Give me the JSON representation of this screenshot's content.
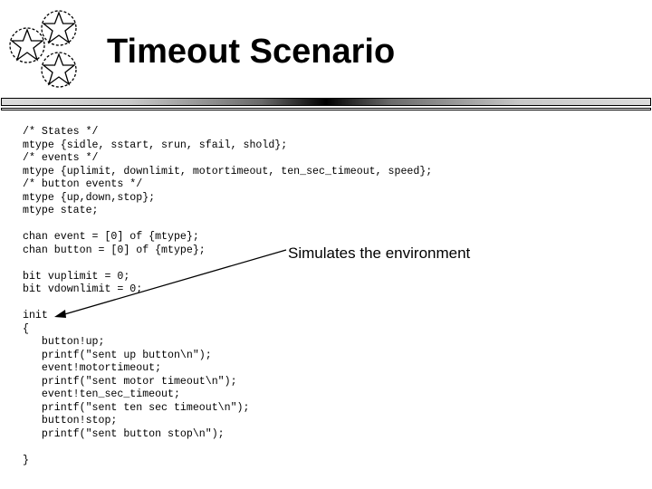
{
  "slide": {
    "title": "Timeout Scenario",
    "logo": "stars-logo-icon",
    "code_lines": [
      "/* States */",
      "mtype {sidle, sstart, srun, sfail, shold};",
      "/* events */",
      "mtype {uplimit, downlimit, motortimeout, ten_sec_timeout, speed};",
      "/* button events */",
      "mtype {up,down,stop};",
      "mtype state;",
      "",
      "chan event = [0] of {mtype};",
      "chan button = [0] of {mtype};",
      "",
      "bit vuplimit = 0;",
      "bit vdownlimit = 0;",
      "",
      "init",
      "{",
      "   button!up;",
      "   printf(\"sent up button\\n\");",
      "   event!motortimeout;",
      "   printf(\"sent motor timeout\\n\");",
      "   event!ten_sec_timeout;",
      "   printf(\"sent ten sec timeout\\n\");",
      "   button!stop;",
      "   printf(\"sent button stop\\n\");",
      "",
      "}"
    ],
    "annotation": "Simulates the environment",
    "arrow_icon": "arrow-icon"
  }
}
